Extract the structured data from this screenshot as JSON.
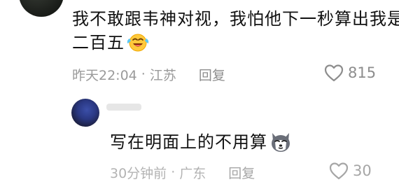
{
  "comment": {
    "text": "我不敢跟韦神对视，我怕他下一秒算出我是二百五",
    "emoji": "laughing-tears-icon",
    "time": "昨天22:04",
    "separator": "·",
    "location": "江苏",
    "reply_label": "回复",
    "likes": "815"
  },
  "reply": {
    "text": "写在明面上的不用算",
    "emoji": "husky-dog-icon",
    "time": "30分钟前",
    "separator": "·",
    "location": "广东",
    "reply_label": "回复",
    "likes": "30"
  }
}
